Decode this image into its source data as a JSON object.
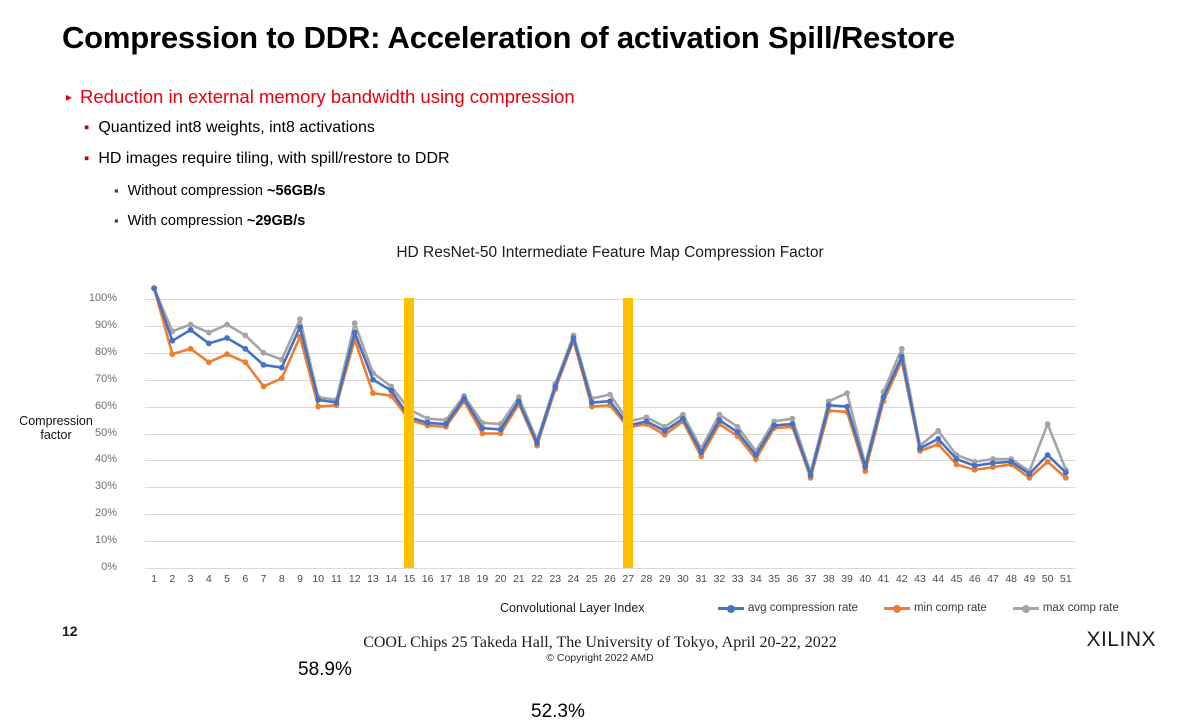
{
  "slide": {
    "title": "Compression to DDR: Acceleration of activation Spill/Restore",
    "page_number": "12",
    "footer": "COOL Chips 25 Takeda Hall, The University of Tokyo, April 20-22, 2022",
    "copyright": "© Copyright 2022 AMD",
    "brand": "XILINX",
    "accent_red": "#e8000d",
    "sub_bullet_red": "#c00000"
  },
  "bullets": {
    "level1": {
      "glyph": "▸",
      "text": "Reduction in external memory bandwidth using compression"
    },
    "level2": [
      {
        "glyph": "▪",
        "text": "Quantized int8 weights, int8 activations"
      },
      {
        "glyph": "▪",
        "text": "HD images require tiling, with spill/restore to DDR"
      }
    ],
    "level3": [
      {
        "glyph": "▪",
        "text": "Without compression ",
        "bold": "~56GB/s"
      },
      {
        "glyph": "▪",
        "text": "With compression ",
        "bold": "~29GB/s"
      }
    ]
  },
  "chart_data": {
    "type": "line",
    "title": "HD ResNet-50 Intermediate Feature Map Compression Factor",
    "xlabel": "Convolutional Layer Index",
    "ylabel": "Compression factor",
    "ylim": [
      0,
      1.0
    ],
    "ytick_labels": [
      "0%",
      "10%",
      "20%",
      "30%",
      "40%",
      "50%",
      "60%",
      "70%",
      "80%",
      "90%",
      "100%"
    ],
    "ytick_values": [
      0,
      10,
      20,
      30,
      40,
      50,
      60,
      70,
      80,
      90,
      100
    ],
    "grid": true,
    "legend_position": "bottom-right",
    "categories": [
      1,
      2,
      3,
      4,
      5,
      6,
      7,
      8,
      9,
      10,
      11,
      12,
      13,
      14,
      15,
      16,
      17,
      18,
      19,
      20,
      21,
      22,
      23,
      24,
      25,
      26,
      27,
      28,
      29,
      30,
      31,
      32,
      33,
      34,
      35,
      36,
      37,
      38,
      39,
      40,
      41,
      42,
      43,
      44,
      45,
      46,
      47,
      48,
      49,
      50,
      51
    ],
    "series": [
      {
        "name": "avg compression rate",
        "color": "#4472c4",
        "values": [
          104,
          84.5,
          88.5,
          83.5,
          85.5,
          81.5,
          75.5,
          74.5,
          89.5,
          62.5,
          61.5,
          87.5,
          70,
          66,
          56,
          54,
          53.5,
          63,
          52,
          51.5,
          62,
          46.5,
          67.5,
          85.5,
          61.5,
          62,
          53,
          54.5,
          51,
          55.5,
          43,
          55,
          50.5,
          42,
          53,
          53.5,
          34.5,
          60.5,
          60,
          37.5,
          63.5,
          78.5,
          44.5,
          48,
          40.5,
          38,
          39,
          39.5,
          35,
          42,
          35.5
        ]
      },
      {
        "name": "min comp rate",
        "color": "#ed7d31",
        "values": [
          104,
          79.5,
          81.5,
          76.5,
          79.5,
          76.5,
          67.5,
          70.5,
          86,
          60,
          60.5,
          85,
          65,
          64,
          55,
          53,
          52.5,
          62,
          50,
          50,
          61,
          45.5,
          66.5,
          84.5,
          60,
          60.5,
          52.3,
          53.5,
          49.5,
          54.5,
          41.5,
          53.5,
          49,
          40.5,
          52,
          52.5,
          33.5,
          58.5,
          58,
          36,
          62,
          77,
          43.5,
          46,
          38.5,
          36.5,
          37.5,
          38.5,
          33.5,
          39.5,
          33.5
        ]
      },
      {
        "name": "max comp rate",
        "color": "#a5a5a5",
        "values": [
          104,
          88,
          90.5,
          87.5,
          90.5,
          86.5,
          80,
          77.5,
          92.5,
          63.5,
          62.5,
          91,
          72.5,
          67.5,
          58.9,
          55.5,
          55,
          64,
          54,
          53.5,
          63.5,
          47.5,
          68.5,
          86.5,
          63,
          64.5,
          54.5,
          56,
          52.5,
          57,
          44.5,
          57,
          52.5,
          43.5,
          54.5,
          55.5,
          35.5,
          62,
          65,
          38.5,
          65.5,
          81.5,
          45.5,
          51,
          42,
          39.5,
          40.5,
          40.5,
          36,
          53.5,
          36.5
        ]
      }
    ],
    "annotations": [
      {
        "label": "58.9%",
        "points_to_x": 15
      },
      {
        "label": "52.3%",
        "points_to_x": 27
      }
    ],
    "marker_bands": [
      {
        "at_x": 15,
        "color": "#ffc000"
      },
      {
        "at_x": 27,
        "color": "#ffc000"
      }
    ]
  }
}
